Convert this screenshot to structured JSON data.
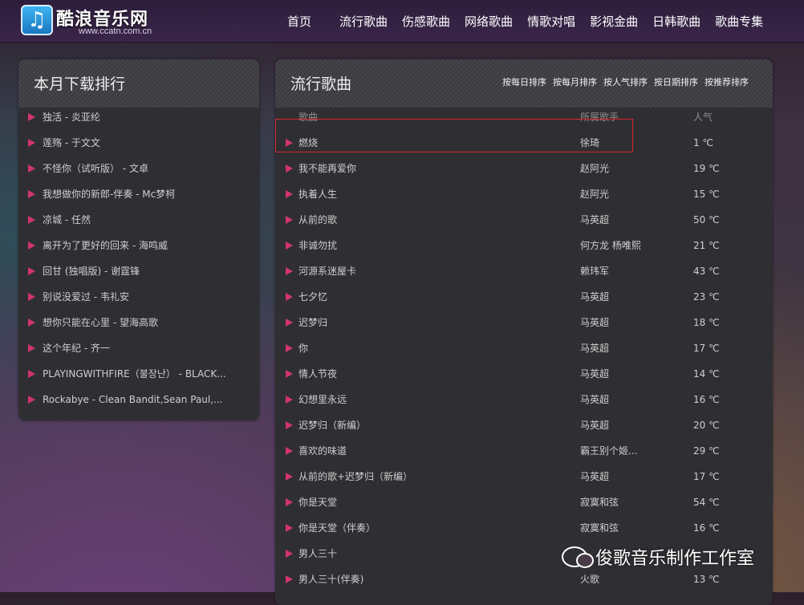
{
  "header": {
    "logo_icon": "music-note-icon",
    "logo_title": "酷浪音乐网",
    "logo_url": "www.ccatn.com.cn",
    "nav": [
      "首页",
      "流行歌曲",
      "伤感歌曲",
      "网络歌曲",
      "情歌对唱",
      "影视金曲",
      "日韩歌曲",
      "歌曲专集"
    ]
  },
  "left_panel": {
    "title": "本月下载排行",
    "items": [
      "独活 - 炎亚纶",
      "莲殇 - 于文文",
      "不怪你（试听版） - 文卓",
      "我想做你的新郎-伴奏 - Mc梦柯",
      "凉城 - 任然",
      "离开为了更好的回来 - 海鸣威",
      "回甘 (独唱版) - 谢霆锋",
      "别说没爱过 - 韦礼安",
      "想你只能在心里 - 望海高歌",
      "这个年纪 - 齐一",
      "PLAYINGWITHFIRE（불장난） - BLACK...",
      "Rockabye - Clean Bandit,Sean Paul,..."
    ]
  },
  "right_panel": {
    "title": "流行歌曲",
    "sort_links": [
      "按每日排序",
      "按每月排序",
      "按人气排序",
      "按日期排序",
      "按推荐排序"
    ],
    "columns": {
      "song": "歌曲",
      "artist": "所属歌手",
      "popularity": "人气"
    },
    "rows": [
      {
        "song": "燃烧",
        "artist": "徐琦",
        "pop": "1 ℃"
      },
      {
        "song": "我不能再爱你",
        "artist": "赵阿光",
        "pop": "19 ℃"
      },
      {
        "song": "执着人生",
        "artist": "赵阿光",
        "pop": "15 ℃"
      },
      {
        "song": "从前的歌",
        "artist": "马英超",
        "pop": "50 ℃"
      },
      {
        "song": "非诚勿扰",
        "artist": "何方龙 杨唯熙",
        "pop": "21 ℃"
      },
      {
        "song": "河源系迷屋卡",
        "artist": "赖玮军",
        "pop": "43 ℃"
      },
      {
        "song": "七夕忆",
        "artist": "马英超",
        "pop": "23 ℃"
      },
      {
        "song": "迟梦归",
        "artist": "马英超",
        "pop": "18 ℃"
      },
      {
        "song": "你",
        "artist": "马英超",
        "pop": "17 ℃"
      },
      {
        "song": "情人节夜",
        "artist": "马英超",
        "pop": "14 ℃"
      },
      {
        "song": "幻想里永远",
        "artist": "马英超",
        "pop": "16 ℃"
      },
      {
        "song": "迟梦归（新编）",
        "artist": "马英超",
        "pop": "20 ℃"
      },
      {
        "song": "喜欢的味道",
        "artist": "霸王别个姬...",
        "pop": "29 ℃"
      },
      {
        "song": "从前的歌+迟梦归（新编）",
        "artist": "马英超",
        "pop": "17 ℃"
      },
      {
        "song": "你是天堂",
        "artist": "寂寞和弦",
        "pop": "54 ℃"
      },
      {
        "song": "你是天堂（伴奏）",
        "artist": "寂寞和弦",
        "pop": "16 ℃"
      },
      {
        "song": "男人三十",
        "artist": "",
        "pop": ""
      },
      {
        "song": "男人三十(伴奏)",
        "artist": "火歌",
        "pop": "13 ℃"
      }
    ]
  },
  "watermark": {
    "icon": "wechat-icon",
    "text": "俊歌音乐制作工作室"
  },
  "colors": {
    "accent_triangle": "#d2356a",
    "highlight_border": "#d8262f"
  }
}
